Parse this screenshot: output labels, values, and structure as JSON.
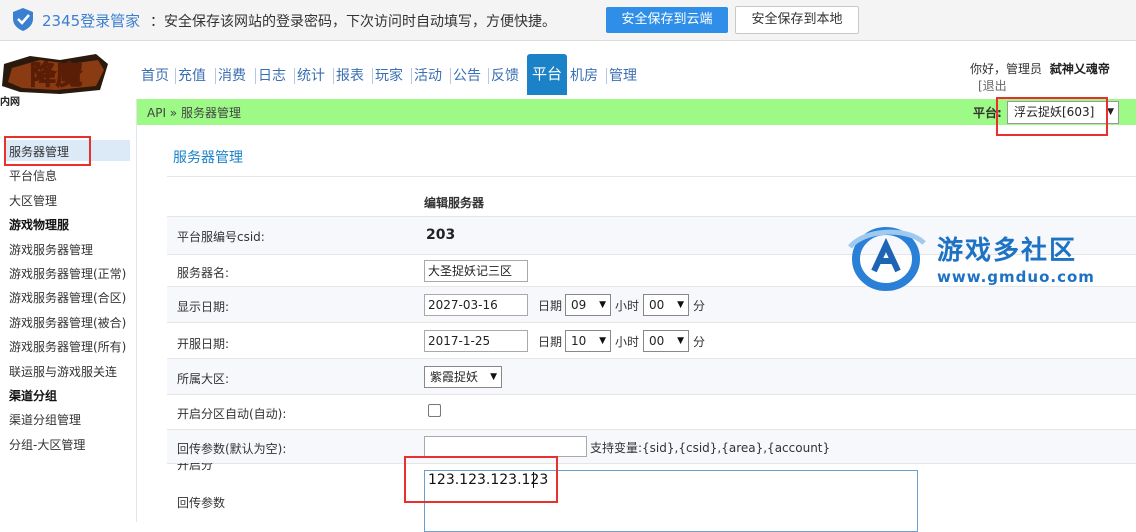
{
  "password_bar": {
    "brand": "2345登录管家",
    "message": "：安全保存该网站的登录密码，下次访问时自动填写，方便快捷。",
    "cloud_button": "安全保存到云端",
    "local_button": "安全保存到本地"
  },
  "logo": {
    "text": "降魔",
    "sub": "内网"
  },
  "nav": {
    "items": [
      "首页",
      "充值",
      "消费",
      "日志",
      "统计",
      "报表",
      "玩家",
      "活动",
      "公告",
      "反馈",
      "平台",
      "机房",
      "管理"
    ],
    "active": "平台"
  },
  "user": {
    "greeting": "你好，管理员",
    "name": "弑神乂魂帝",
    "logout": "[退出"
  },
  "breadcrumb": {
    "text": "API » 服务器管理"
  },
  "platform": {
    "label": "平台:",
    "selected": "浮云捉妖[603]"
  },
  "sidebar": {
    "items": [
      {
        "label": "服务器管理",
        "type": "item"
      },
      {
        "label": "平台信息",
        "type": "item"
      },
      {
        "label": "大区管理",
        "type": "item"
      },
      {
        "label": "游戏物理服",
        "type": "header"
      },
      {
        "label": "游戏服务器管理",
        "type": "item"
      },
      {
        "label": "游戏服务器管理(正常)",
        "type": "item"
      },
      {
        "label": "游戏服务器管理(合区)",
        "type": "item"
      },
      {
        "label": "游戏服务器管理(被合)",
        "type": "item"
      },
      {
        "label": "游戏服务器管理(所有)",
        "type": "item"
      },
      {
        "label": "联运服与游戏服关连",
        "type": "item"
      },
      {
        "label": "渠道分组",
        "type": "header"
      },
      {
        "label": "渠道分组管理",
        "type": "item"
      },
      {
        "label": "分组-大区管理",
        "type": "item"
      }
    ]
  },
  "main": {
    "title": "服务器管理",
    "form_title": "编辑服务器",
    "fields": {
      "csid_label": "平台服编号csid:",
      "csid_value": "203",
      "name_label": "服务器名:",
      "name_value": "大圣捉妖记三区",
      "display_date_label": "显示日期:",
      "display_date_value": "2027-03-16",
      "display_hour": "09",
      "display_min": "00",
      "open_date_label": "开服日期:",
      "open_date_value": "2017-1-25",
      "open_hour": "10",
      "open_min": "00",
      "date_word": "日期",
      "hour_word": "小时",
      "min_word": "分",
      "area_label": "所属大区:",
      "area_value": "紫霞捉妖",
      "auto_label": "开启分区自动(自动):",
      "callback_label": "回传参数(默认为空):",
      "callback_value": "",
      "callback_hint": "支持变量:{sid},{csid},{area},{account}",
      "partial_label": "开启分",
      "callback2_label": "回传参数",
      "ip_value": "123.123.123.123"
    }
  },
  "watermark": {
    "name": "游戏多社区",
    "url": "www.gmduo.com"
  },
  "colors": {
    "accent": "#1b82c7",
    "breadcrumb_bg": "#9dfa86",
    "highlight_box": "#e8302c",
    "primary_button": "#2f8fe8"
  }
}
